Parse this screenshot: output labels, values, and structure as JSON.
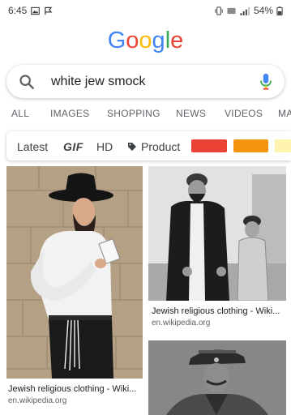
{
  "status_bar": {
    "time": "6:45",
    "battery": "54%"
  },
  "logo": {
    "letters": [
      "G",
      "o",
      "o",
      "g",
      "l",
      "e"
    ],
    "colors": [
      "#4285F4",
      "#EA4335",
      "#FBBC05",
      "#4285F4",
      "#34A853",
      "#EA4335"
    ]
  },
  "search": {
    "query": "white jew smock"
  },
  "tabs": [
    "ALL",
    "IMAGES",
    "SHOPPING",
    "NEWS",
    "VIDEOS",
    "MA"
  ],
  "filters": {
    "latest": "Latest",
    "gif": "GIF",
    "hd": "HD",
    "product": "Product",
    "color_chips": [
      "#E94235",
      "#F5940F",
      "#FFF3B0"
    ]
  },
  "results": [
    {
      "title": "Jewish religious clothing - Wiki...",
      "source": "en.wikipedia.org"
    },
    {
      "title": "Jewish religious clothing - Wiki...",
      "source": "en.wikipedia.org"
    }
  ],
  "accent_colors": {
    "google_blue": "#4285F4",
    "mic_red": "#EA4335"
  }
}
